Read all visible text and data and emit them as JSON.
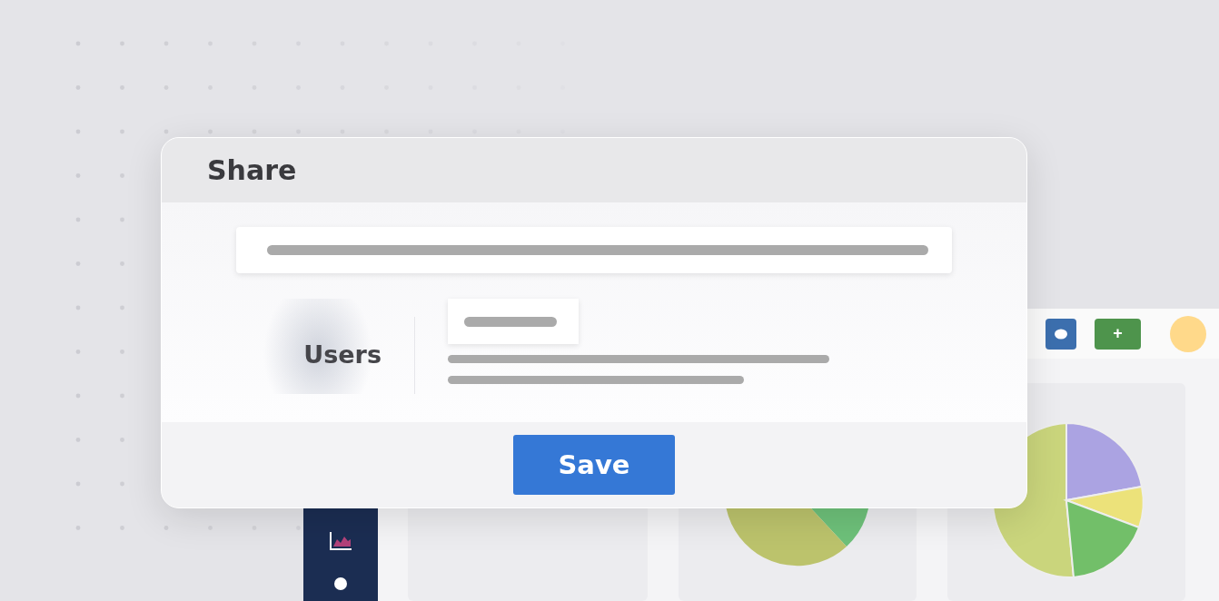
{
  "dialog": {
    "title": "Share",
    "row_label": "Users",
    "save_button": "Save"
  },
  "toolbar": {
    "add_button": "+"
  }
}
